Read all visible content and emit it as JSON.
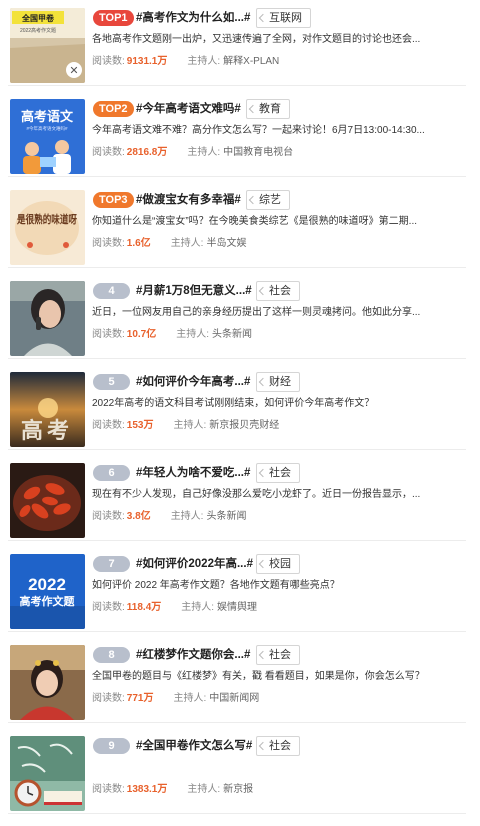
{
  "labels": {
    "reads": "阅读数:",
    "host": "主持人:"
  },
  "items": [
    {
      "rank": "TOP1",
      "title": "#高考作文为什么如...#",
      "tag": "互联网",
      "desc": "各地高考作文题刚一出炉，又迅速传遍了全网，对作文题目的讨论也还会...",
      "reads": "9131.1万",
      "host": "解释X-PLAN",
      "thumb_text": "全国甲卷",
      "thumb_sub": "2022高考作文题"
    },
    {
      "rank": "TOP2",
      "title": "#今年高考语文难吗#",
      "tag": "教育",
      "desc": "今年高考语文难不难？高分作文怎么写？一起来讨论！6月7日13:00-14:30...",
      "reads": "2816.8万",
      "host": "中国教育电视台",
      "thumb_text": "高考语文",
      "thumb_sub": "#今年高考语文难吗#"
    },
    {
      "rank": "TOP3",
      "title": "#做渡宝女有多幸福#",
      "tag": "综艺",
      "desc": "你知道什么是“渡宝女”吗？在今晚美食类综艺《是很熟的味道呀》第二期...",
      "reads": "1.6亿",
      "host": "半岛文娱",
      "thumb_text": "是很熟的味道呀"
    },
    {
      "rank": "4",
      "title": "#月薪1万8但无意义...#",
      "tag": "社会",
      "desc": "近日，一位网友用自己的亲身经历提出了这样一则灵魂拷问。他如此分享...",
      "reads": "10.7亿",
      "host": "头条新闻"
    },
    {
      "rank": "5",
      "title": "#如何评价今年高考...#",
      "tag": "财经",
      "desc": "2022年高考的语文科目考试刚刚结束，如何评价今年高考作文？",
      "reads": "153万",
      "host": "新京报贝壳财经",
      "thumb_text": "高考"
    },
    {
      "rank": "6",
      "title": "#年轻人为啥不爱吃...#",
      "tag": "社会",
      "desc": "现在有不少人发现，自己好像没那么爱吃小龙虾了。近日一份报告显示，...",
      "reads": "3.8亿",
      "host": "头条新闻"
    },
    {
      "rank": "7",
      "title": "#如何评价2022年高...#",
      "tag": "校园",
      "desc": "如何评价 2022 年高考作文题？各地作文题有哪些亮点？",
      "reads": "118.4万",
      "host": "娱情舆理",
      "thumb_text": "2022",
      "thumb_sub": "高考作文题"
    },
    {
      "rank": "8",
      "title": "#红楼梦作文题你会...#",
      "tag": "社会",
      "desc": "全国甲卷的题目与《红楼梦》有关，戳 看看题目，如果是你，你会怎么写？",
      "reads": "771万",
      "host": "中国新闻网"
    },
    {
      "rank": "9",
      "title": "#全国甲卷作文怎么写#",
      "tag": "社会",
      "desc": "",
      "reads": "1383.1万",
      "host": "新京报"
    }
  ],
  "colors": {
    "top1": "#e8473c",
    "top23": "#f0782c",
    "rank_default": "#b8bfcc",
    "count": "#e8612c"
  }
}
